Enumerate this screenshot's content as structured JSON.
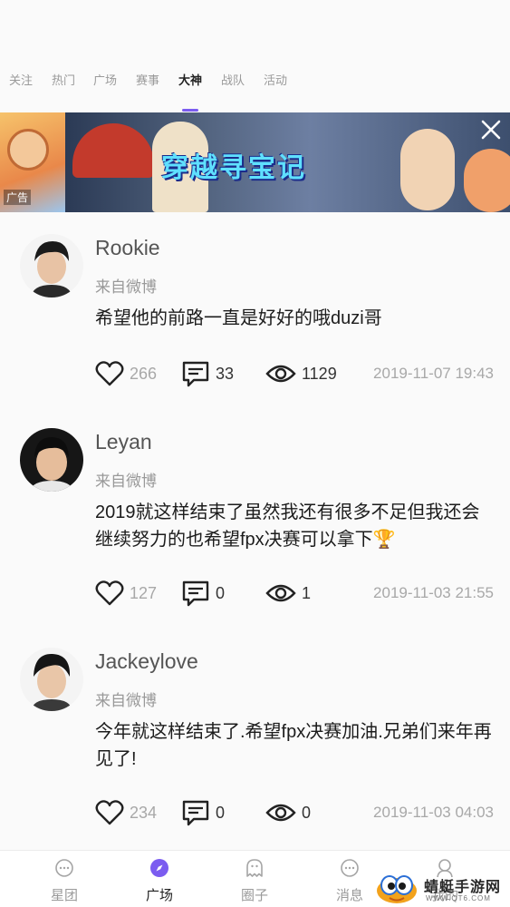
{
  "tabs": [
    {
      "label": "关注",
      "active": false
    },
    {
      "label": "热门",
      "active": false
    },
    {
      "label": "广场",
      "active": false
    },
    {
      "label": "赛事",
      "active": false
    },
    {
      "label": "大神",
      "active": true
    },
    {
      "label": "战队",
      "active": false
    },
    {
      "label": "活动",
      "active": false
    }
  ],
  "ad": {
    "title": "穿越寻宝记",
    "label": "广告",
    "close_icon": "close-icon"
  },
  "posts": [
    {
      "name": "Rookie",
      "source": "来自微博",
      "content": "希望他的前路一直是好好的哦duzi哥",
      "likes": "266",
      "comments": "33",
      "views": "1129",
      "time": "2019-11-07 19:43"
    },
    {
      "name": "Leyan",
      "source": "来自微博",
      "content": "2019就这样结束了虽然我还有很多不足但我还会继续努力的也希望fpx决赛可以拿下🏆",
      "likes": "127",
      "comments": "0",
      "views": "1",
      "time": "2019-11-03 21:55"
    },
    {
      "name": "Jackeylove",
      "source": "来自微博",
      "content": "今年就这样结束了.希望fpx决赛加油.兄弟们来年再见了!",
      "likes": "234",
      "comments": "0",
      "views": "0",
      "time": "2019-11-03 04:03"
    }
  ],
  "bottom_nav": [
    {
      "label": "星团",
      "icon": "chat-bubble-icon",
      "active": false
    },
    {
      "label": "广场",
      "icon": "compass-icon",
      "active": true
    },
    {
      "label": "圈子",
      "icon": "ghost-icon",
      "active": false
    },
    {
      "label": "消息",
      "icon": "message-icon",
      "active": false
    },
    {
      "label": "我的",
      "icon": "profile-icon",
      "active": false
    }
  ],
  "watermark": {
    "text": "蜻蜓手游网",
    "url": "WWW.QT6.COM"
  },
  "colors": {
    "accent": "#7b5cf0",
    "text_primary": "#1c1c1c",
    "text_secondary": "#999999"
  }
}
